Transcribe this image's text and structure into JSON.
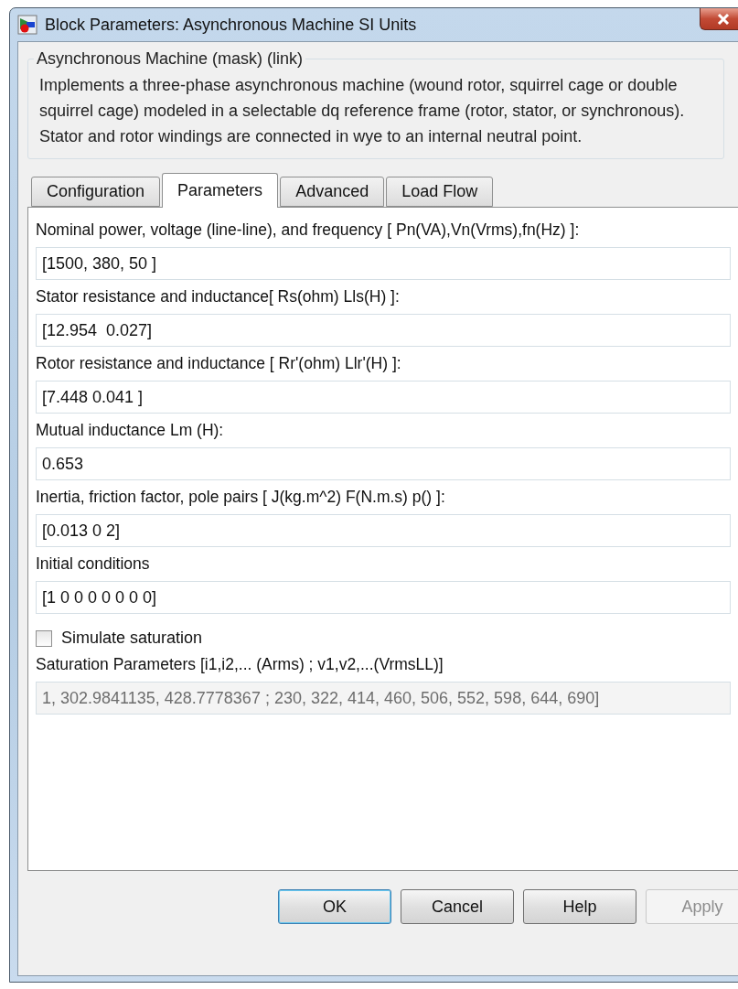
{
  "window": {
    "title": "Block Parameters: Asynchronous Machine SI Units"
  },
  "group": {
    "title": "Asynchronous Machine (mask) (link)",
    "description": "Implements a three-phase asynchronous machine (wound rotor, squirrel cage or double squirrel cage) modeled in a selectable dq reference frame (rotor, stator, or synchronous). Stator and rotor windings are connected in wye to an internal neutral point."
  },
  "tabs": [
    {
      "label": "Configuration",
      "selected": false
    },
    {
      "label": "Parameters",
      "selected": true
    },
    {
      "label": "Advanced",
      "selected": false
    },
    {
      "label": "Load Flow",
      "selected": false
    }
  ],
  "parameters": [
    {
      "kind": "field",
      "label": "Nominal power, voltage (line-line), and frequency [ Pn(VA),Vn(Vrms),fn(Hz) ]:",
      "value": "[1500, 380, 50 ]",
      "disabled": false
    },
    {
      "kind": "field",
      "label": "Stator resistance and inductance[ Rs(ohm)  Lls(H) ]:",
      "value": "[12.954  0.027]",
      "disabled": false
    },
    {
      "kind": "field",
      "label": "Rotor resistance and inductance [ Rr'(ohm)  Llr'(H) ]:",
      "value": "[7.448 0.041 ]",
      "disabled": false
    },
    {
      "kind": "field",
      "label": "Mutual inductance Lm (H):",
      "value": "0.653",
      "disabled": false
    },
    {
      "kind": "field",
      "label": "Inertia, friction factor, pole pairs [ J(kg.m^2)  F(N.m.s)   p() ]:",
      "value": "[0.013 0 2]",
      "disabled": false
    },
    {
      "kind": "field",
      "label": "Initial conditions",
      "value": "[1 0 0 0 0 0 0 0]",
      "disabled": false
    },
    {
      "kind": "checkbox",
      "label": "Simulate saturation",
      "checked": false
    },
    {
      "kind": "field",
      "label": "Saturation Parameters [i1,i2,... (Arms) ; v1,v2,...(VrmsLL)]",
      "value": "1, 302.9841135, 428.7778367 ; 230, 322, 414, 460, 506, 552, 598, 644, 690]",
      "disabled": true
    }
  ],
  "buttons": [
    {
      "label": "OK",
      "default": true,
      "disabled": false
    },
    {
      "label": "Cancel",
      "default": false,
      "disabled": false
    },
    {
      "label": "Help",
      "default": false,
      "disabled": false
    },
    {
      "label": "Apply",
      "default": false,
      "disabled": true
    }
  ]
}
